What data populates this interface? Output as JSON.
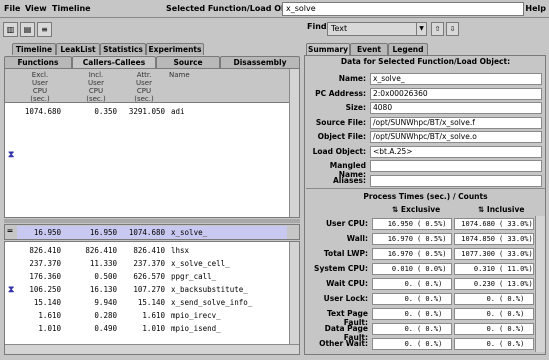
{
  "menu": {
    "file": "File",
    "view": "View",
    "timeline": "Timeline",
    "help": "Help"
  },
  "selected": {
    "label": "Selected Function/Load Object:",
    "value": "x_solve"
  },
  "find": {
    "label": "Find",
    "mode": "Text"
  },
  "top_tabs": [
    "Timeline",
    "LeakList",
    "Statistics",
    "Experiments"
  ],
  "sub_tabs": [
    "Functions",
    "Callers-Callees",
    "Source",
    "Disassembly"
  ],
  "right_tabs": [
    "Summary",
    "Event",
    "Legend"
  ],
  "columns": [
    {
      "l1": "Excl.",
      "l2": "User",
      "l3": "CPU",
      "l4": "(sec.)"
    },
    {
      "l1": "Incl.",
      "l2": "User",
      "l3": "CPU",
      "l4": "(sec.)"
    },
    {
      "l1": "Attr.",
      "l2": "User",
      "l3": "CPU",
      "l4": "(sec.)"
    },
    {
      "l1": "Name",
      "l2": "",
      "l3": "",
      "l4": ""
    }
  ],
  "callers": [
    {
      "excl": "1074.680",
      "incl": "0.350",
      "attr": "3291.050",
      "name": "adi"
    }
  ],
  "selected_row": {
    "excl": "16.950",
    "incl": "16.950",
    "attr": "1074.680",
    "name": "x_solve_"
  },
  "callees": [
    {
      "excl": "826.410",
      "incl": "826.410",
      "attr": "826.410",
      "name": "lhsx"
    },
    {
      "excl": "237.370",
      "incl": "11.330",
      "attr": "237.370",
      "name": "x_solve_cell_"
    },
    {
      "excl": "176.360",
      "incl": "0.500",
      "attr": "626.570",
      "name": "ppgr_call_"
    },
    {
      "excl": "106.250",
      "incl": "16.130",
      "attr": "107.270",
      "name": "x_backsubstitute_"
    },
    {
      "excl": "15.140",
      "incl": "9.940",
      "attr": "15.140",
      "name": "x_send_solve_info_"
    },
    {
      "excl": "1.610",
      "incl": "0.280",
      "attr": "1.610",
      "name": "mpio_irecv_"
    },
    {
      "excl": "1.010",
      "incl": "0.490",
      "attr": "1.010",
      "name": "mpio_isend_"
    }
  ],
  "summary": {
    "title": "Data for Selected Function/Load Object:",
    "fields": [
      {
        "label": "Name:",
        "value": "x_solve_"
      },
      {
        "label": "PC Address:",
        "value": "2:0x00026360"
      },
      {
        "label": "Size:",
        "value": "4080"
      },
      {
        "label": "Source File:",
        "value": "/opt/SUNWhpc/BT/x_solve.f"
      },
      {
        "label": "Object File:",
        "value": "/opt/SUNWhpc/BT/x_solve.o"
      },
      {
        "label": "Load Object:",
        "value": "<bt.A.25>"
      },
      {
        "label": "Mangled Name:",
        "value": ""
      },
      {
        "label": "Aliases:",
        "value": ""
      }
    ],
    "process_title": "Process Times (sec.) / Counts",
    "exclusive": "Exclusive",
    "inclusive": "Inclusive",
    "metrics": [
      {
        "label": "User CPU:",
        "ex": "16.950",
        "exp": "( 0.5%)",
        "in": "1074.680",
        "inp": "( 33.0%)"
      },
      {
        "label": "Wall:",
        "ex": "16.970",
        "exp": "( 0.5%)",
        "in": "1074.850",
        "inp": "( 33.0%)"
      },
      {
        "label": "Total LWP:",
        "ex": "16.970",
        "exp": "( 0.5%)",
        "in": "1077.300",
        "inp": "( 33.0%)"
      },
      {
        "label": "System CPU:",
        "ex": "0.010",
        "exp": "( 0.0%)",
        "in": "0.310",
        "inp": "( 11.0%)"
      },
      {
        "label": "Wait CPU:",
        "ex": "0.",
        "exp": "( 0.%)",
        "in": "0.230",
        "inp": "( 13.0%)"
      },
      {
        "label": "User Lock:",
        "ex": "0.",
        "exp": "( 0.%)",
        "in": "0.",
        "inp": "( 0.%)"
      },
      {
        "label": "Text Page Fault:",
        "ex": "0.",
        "exp": "( 0.%)",
        "in": "0.",
        "inp": "( 0.%)"
      },
      {
        "label": "Data Page Fault:",
        "ex": "0.",
        "exp": "( 0.%)",
        "in": "0.",
        "inp": "( 0.%)"
      },
      {
        "label": "Other Wait:",
        "ex": "0.",
        "exp": "( 0.%)",
        "in": "0.",
        "inp": "( 0.%)"
      }
    ]
  },
  "colors": {
    "highlight": "#c8c8f0",
    "background": "#c6c6c6"
  }
}
